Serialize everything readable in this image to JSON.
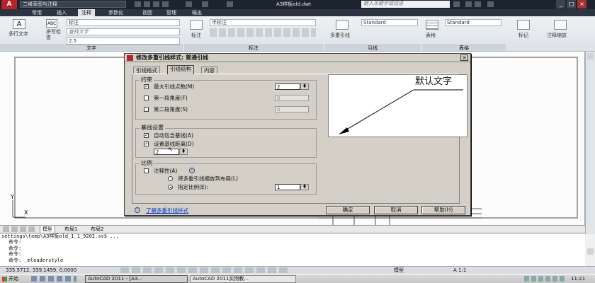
{
  "title_bar": {
    "workspace": "二维草图与注释",
    "document": "A3样板old.dwt",
    "search_placeholder": "键入关键字或短语"
  },
  "ribbon_tabs": [
    "常用",
    "插入",
    "注释",
    "参数化",
    "视图",
    "管理",
    "输出"
  ],
  "ribbon": {
    "text_panel": {
      "multiline_text": "多行文字",
      "spell_check": "拼写检查",
      "style_value": "标注",
      "find_placeholder": "查找文字",
      "height_value": "2.5",
      "label": "文字"
    },
    "dim_panel": {
      "style_value": "半标注",
      "dim_label": "标注",
      "label": "标注"
    },
    "leader_panel": {
      "multileader": "多重引线",
      "style_value": "Standard",
      "label": "引线"
    },
    "table_panel": {
      "table": "表格",
      "style_value": "Standard",
      "label": "表格"
    },
    "markup": {
      "mark": "标记",
      "annotation_scale": "注释缩放"
    }
  },
  "dialog": {
    "title": "修改多重引线样式: 普通引线",
    "tabs": [
      "引线格式",
      "引线结构",
      "内容"
    ],
    "active_tab": 1,
    "constraints": {
      "group_label": "约束",
      "max_points": {
        "label": "最大引线点数(M)",
        "checked": true,
        "value": "2"
      },
      "first_angle": {
        "label": "第一段角度(F)",
        "checked": false,
        "value": "0"
      },
      "second_angle": {
        "label": "第二段角度(S)",
        "checked": false,
        "value": "0"
      }
    },
    "landing": {
      "group_label": "基线设置",
      "auto_landing": {
        "label": "自动包含基线(A)",
        "checked": true
      },
      "set_distance": {
        "label": "设置基线距离(D)",
        "checked": true
      },
      "distance_value": "2"
    },
    "scale": {
      "group_label": "比例",
      "annotative": {
        "label": "注释性(A)",
        "checked": false
      },
      "scale_to_layout": {
        "label": "将多重引线缩放到布局(L)"
      },
      "specify_scale": {
        "label": "指定比例(E):",
        "value": "1"
      }
    },
    "preview_text": "默认文字",
    "help_link": "了解多重引线样式",
    "buttons": {
      "ok": "确定",
      "cancel": "取消",
      "help": "帮助(H)"
    }
  },
  "layout_tabs": [
    "模型",
    "布局1",
    "布局2"
  ],
  "command_lines": [
    "settings\\temp\\A3样板old_1_1_9202.sv$ ...",
    "命令:",
    "命令:",
    "命令:",
    "命令: _mleaderstyle"
  ],
  "status_bar": {
    "coords": "335.5712, 339.1459, 0.0000",
    "model": "模型",
    "scale": "A 1:1"
  },
  "taskbar": {
    "start": "开始",
    "tasks": [
      "AutoCAD 2011 - [A3...",
      "AutoCAD 2011实例教..."
    ],
    "clock": "11:21"
  }
}
